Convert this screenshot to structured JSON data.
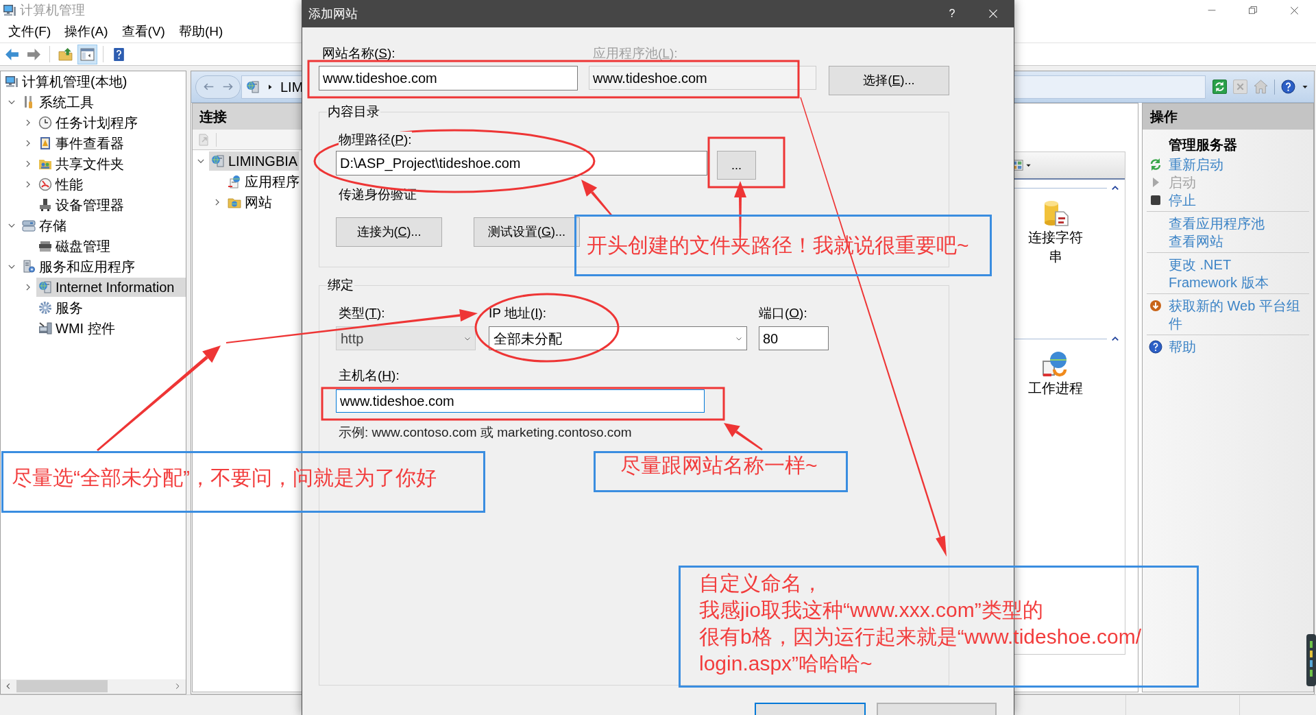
{
  "window": {
    "title": "计算机管理"
  },
  "menu": [
    "文件(F)",
    "操作(A)",
    "查看(V)",
    "帮助(H)"
  ],
  "toolbar": [
    {
      "kind": "back",
      "pressed": false
    },
    {
      "kind": "forward",
      "pressed": false
    },
    {
      "kind": "up",
      "pressed": false
    },
    {
      "kind": "console_tree",
      "pressed": true
    },
    {
      "kind": "help",
      "pressed": false
    }
  ],
  "tree": [
    {
      "label": "计算机管理(本地)",
      "selected": false,
      "children": [
        {
          "label": "系统工具",
          "expanded": true,
          "selected": false,
          "children": [
            {
              "label": "任务计划程序",
              "expanded": false,
              "selected": false
            },
            {
              "label": "事件查看器",
              "expanded": false,
              "selected": false
            },
            {
              "label": "共享文件夹",
              "expanded": false,
              "selected": false
            },
            {
              "label": "性能",
              "expanded": false,
              "selected": false
            },
            {
              "label": "设备管理器",
              "selected": false
            }
          ]
        },
        {
          "label": "存储",
          "expanded": true,
          "selected": false,
          "children": [
            {
              "label": "磁盘管理",
              "selected": false
            }
          ]
        },
        {
          "label": "服务和应用程序",
          "expanded": true,
          "selected": false,
          "children": [
            {
              "label": "Internet Information",
              "expanded": false,
              "selected": true
            },
            {
              "label": "服务",
              "selected": false
            },
            {
              "label": "WMI 控件",
              "selected": false
            }
          ]
        }
      ]
    }
  ],
  "iis": {
    "breadcrumb": "LIM",
    "connections": {
      "title": "连接",
      "tree": [
        {
          "label": "LIMINGBIA",
          "expanded": true,
          "selected": true,
          "children": [
            {
              "label": "应用程序",
              "selected": false
            },
            {
              "label": "网站",
              "expanded": false,
              "selected": false
            }
          ]
        }
      ]
    },
    "feature_groups": [
      {
        "expanded": true,
        "tiles": [
          {
            "label": "连接字符串"
          }
        ]
      },
      {
        "expanded": true,
        "tiles": [
          {
            "label": "工作进程"
          }
        ]
      }
    ],
    "actions": {
      "title": "操作",
      "sections": [
        {
          "heading": "管理服务器",
          "items": [
            {
              "lines": [
                "重新启动"
              ],
              "disabled": false
            },
            {
              "lines": [
                "启动"
              ],
              "disabled": true
            },
            {
              "lines": [
                "停止"
              ],
              "disabled": false
            }
          ]
        },
        {
          "items": [
            {
              "lines": [
                "查看应用程序池"
              ],
              "disabled": false
            },
            {
              "lines": [
                "查看网站"
              ],
              "disabled": false
            }
          ]
        },
        {
          "items": [
            {
              "lines": [
                "更改 .NET",
                "Framework 版本"
              ],
              "disabled": false
            }
          ]
        },
        {
          "items": [
            {
              "lines": [
                "获取新的 Web 平台组",
                "件"
              ],
              "disabled": false
            }
          ]
        },
        {
          "items": [
            {
              "lines": [
                "帮助"
              ],
              "disabled": false
            }
          ]
        }
      ]
    }
  },
  "dialog": {
    "title": "添加网站",
    "help": "?",
    "site_name": {
      "label": [
        "网站名称(",
        "S",
        "):"
      ],
      "value": "www.tideshoe.com"
    },
    "app_pool": {
      "label": [
        "应用程序池(",
        "L",
        "):"
      ],
      "value": "www.tideshoe.com",
      "disabled": true
    },
    "select_button": [
      "选择(",
      "E",
      ")..."
    ],
    "content_directory": {
      "title": "内容目录",
      "physical_path": {
        "label": [
          "物理路径(",
          "P",
          "):"
        ],
        "value": "D:\\ASP_Project\\tideshoe.com"
      },
      "browse_button": "...",
      "pass_through": "传递身份验证",
      "buttons": [
        [
          "连接为(",
          "C",
          ")..."
        ],
        [
          "测试设置(",
          "G",
          ")..."
        ]
      ]
    },
    "binding": {
      "title": "绑定",
      "type": {
        "label": [
          "类型(",
          "T",
          "):"
        ],
        "value": "http",
        "disabled": true
      },
      "ip_address": {
        "label": [
          "IP 地址(",
          "I",
          "):"
        ],
        "value": "全部未分配",
        "disabled": false
      },
      "port": {
        "label": [
          "端口(",
          "O",
          "):"
        ],
        "value": "80"
      },
      "host_name": {
        "label": [
          "主机名(",
          "H",
          "):"
        ],
        "value": "www.tideshoe.com",
        "focused": true
      },
      "example": "示例: www.contoso.com 或 marketing.contoso.com"
    },
    "footer_buttons": [
      {
        "default": true
      },
      {
        "default": false
      }
    ]
  },
  "notes": [
    {
      "lines": [
        "开头创建的文件夹路径！我就说很重要吧~"
      ]
    },
    {
      "lines": [
        "尽量选“全部未分配”，不要问，问就是为了你好"
      ]
    },
    {
      "lines": [
        "尽量跟网站名称一样~"
      ]
    },
    {
      "lines": [
        "自定义命名，",
        "我感jio取我这种“www.xxx.com”类型的",
        "很有b格，因为运行起来就是“www.tideshoe.com/",
        "login.aspx”哈哈哈~"
      ]
    }
  ]
}
